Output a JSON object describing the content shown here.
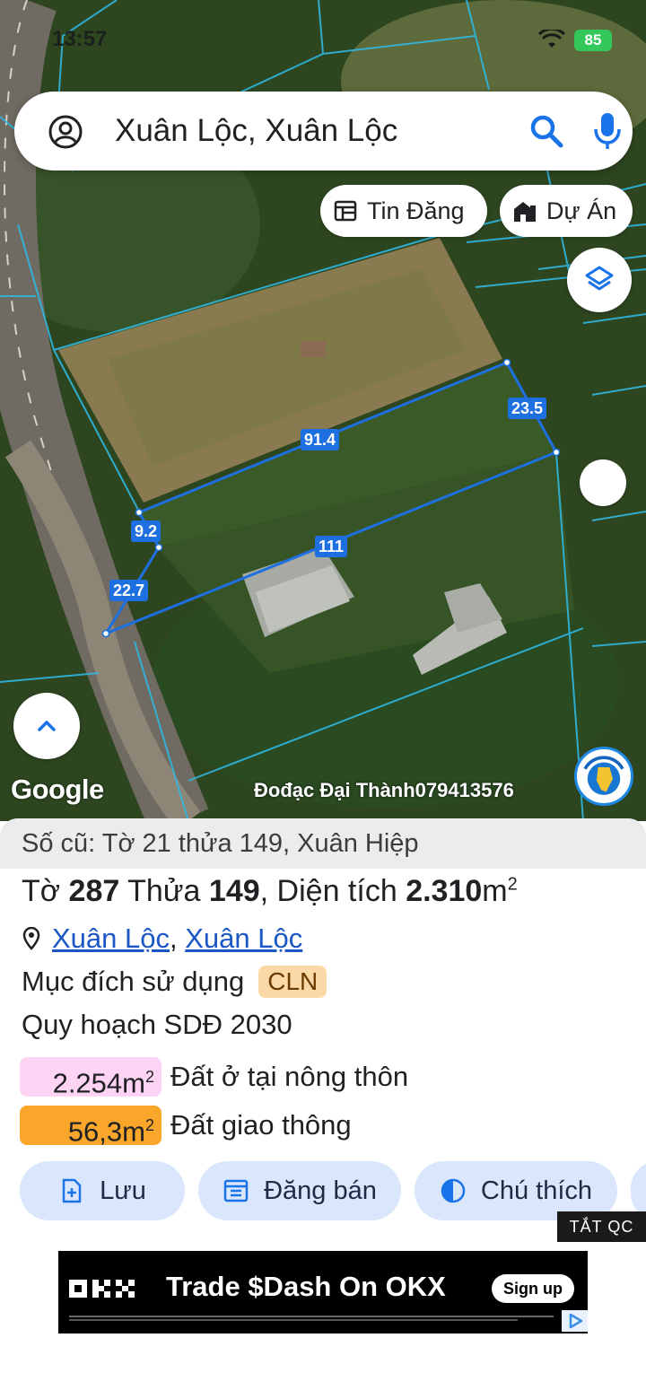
{
  "status_bar": {
    "time": "13:57",
    "battery": "85"
  },
  "search": {
    "query": "Xuân Lộc, Xuân Lộc"
  },
  "chips": {
    "news": "Tin Đăng",
    "project": "Dự Án"
  },
  "map": {
    "dimensions": [
      "91.4",
      "23.5",
      "111",
      "9.2",
      "22.7"
    ],
    "google_logo": "Google",
    "watermark": "Đođạc Đại Thành079413576"
  },
  "parcel": {
    "old_ref": "Số cũ: Tờ 21 thửa 149, Xuân Hiệp",
    "sheet_label": "Tờ",
    "sheet_no": "287",
    "plot_label": "Thửa",
    "plot_no": "149",
    "area_label": ", Diện tích",
    "area_value": "2.310",
    "area_unit": "m",
    "area_exp": "2",
    "address_ward": "Xuân Lộc",
    "address_sep": ",",
    "address_district": "Xuân Lộc",
    "purpose_label": "Mục đích sử dụng",
    "purpose_code": "CLN",
    "plan_title": "Quy hoạch SDĐ 2030",
    "plan_items": [
      {
        "qty": "2.254m",
        "exp": "2",
        "label": "Đất ở tại nông thôn",
        "color": "#fdd4f4"
      },
      {
        "qty": "56,3m",
        "exp": "2",
        "label": "Đất giao thông",
        "color": "#f9a62b"
      }
    ]
  },
  "actions": {
    "save": "Lưu",
    "sell": "Đăng bán",
    "legend": "Chú thích"
  },
  "ad": {
    "off_label": "TẮT QC",
    "text": "Trade $Dash On OKX",
    "cta": "Sign up"
  },
  "colors": {
    "accent": "#1a57c4",
    "boundary": "#1e6fe0",
    "button_bg": "#d9e6fb"
  }
}
